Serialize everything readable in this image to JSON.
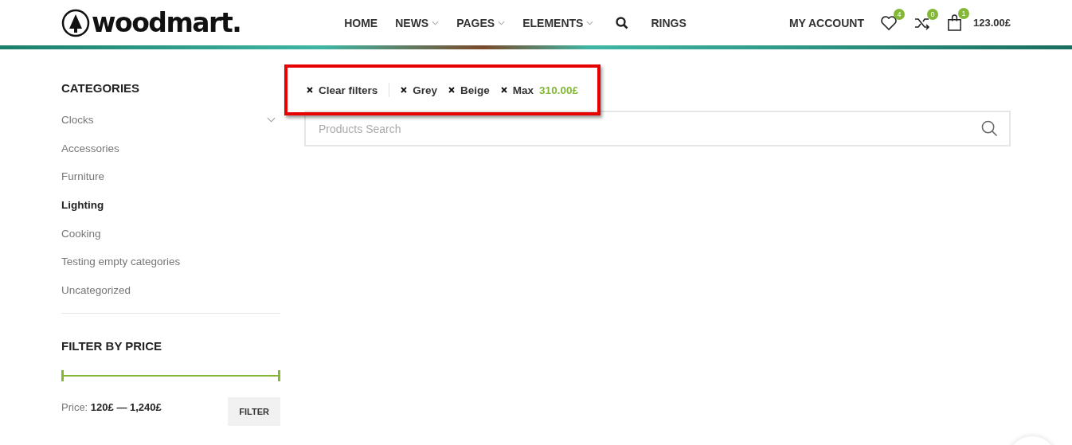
{
  "header": {
    "logo": "woodmart.",
    "nav": [
      {
        "label": "HOME",
        "has_dropdown": false
      },
      {
        "label": "NEWS",
        "has_dropdown": true
      },
      {
        "label": "PAGES",
        "has_dropdown": true
      },
      {
        "label": "ELEMENTS",
        "has_dropdown": true
      },
      {
        "kind": "search"
      },
      {
        "label": "RINGS",
        "has_dropdown": false
      }
    ],
    "account": "MY ACCOUNT",
    "wishlist_count": "4",
    "compare_count": "0",
    "cart_count": "1",
    "cart_total": "123.00£"
  },
  "sidebar": {
    "categories_title": "CATEGORIES",
    "categories": [
      {
        "label": "Clocks",
        "selected": false,
        "has_submenu": true
      },
      {
        "label": "Accessories",
        "selected": false,
        "has_submenu": false
      },
      {
        "label": "Furniture",
        "selected": false,
        "has_submenu": false
      },
      {
        "label": "Lighting",
        "selected": true,
        "has_submenu": false
      },
      {
        "label": "Cooking",
        "selected": false,
        "has_submenu": false
      },
      {
        "label": "Testing empty categories",
        "selected": false,
        "has_submenu": false
      },
      {
        "label": "Uncategorized",
        "selected": false,
        "has_submenu": false
      }
    ],
    "price_title": "FILTER BY PRICE",
    "price_slider": {
      "handles": [
        {
          "level": 0
        },
        {
          "level": 1
        }
      ]
    },
    "price_label": "Price:",
    "price_range": "120£ — 1,240£",
    "filter_button": "FILTER"
  },
  "active_filters": {
    "highlighted": true,
    "items": [
      {
        "kind": "clear",
        "label": "Clear filters"
      },
      {
        "kind": "filter",
        "label": "Grey"
      },
      {
        "kind": "filter",
        "label": "Beige"
      },
      {
        "kind": "price",
        "label": "Max",
        "value": "310.00£"
      }
    ]
  },
  "search": {
    "placeholder": "Products Search"
  }
}
